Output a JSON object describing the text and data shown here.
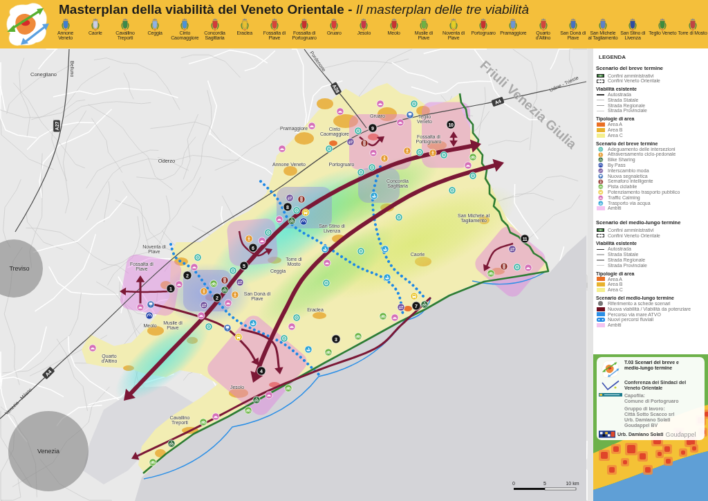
{
  "header": {
    "title": "**Masterplan della viabilità del Veneto Orientale -** *Il masterplan delle tre viabilità*",
    "municipalities": [
      {
        "name": "Annone Veneto",
        "color": "#3f7fd0"
      },
      {
        "name": "Caorle",
        "color": "#c9cfe6"
      },
      {
        "name": "Cavallino Treporti",
        "color": "#3c8a4a"
      },
      {
        "name": "Ceggia",
        "color": "#8fb3e3"
      },
      {
        "name": "Cinto Caomaggiore",
        "color": "#4b93d6"
      },
      {
        "name": "Concordia Sagittaria",
        "color": "#d33a3a"
      },
      {
        "name": "Eraclea",
        "color": "#e6c032"
      },
      {
        "name": "Fossalta di Piave",
        "color": "#d8443a"
      },
      {
        "name": "Fossalta di Portogruaro",
        "color": "#c82f2f"
      },
      {
        "name": "Gruaro",
        "color": "#d93c3c"
      },
      {
        "name": "Jesolo",
        "color": "#c9354a"
      },
      {
        "name": "Meolo",
        "color": "#c93232"
      },
      {
        "name": "Musile di Piave",
        "color": "#6cb244"
      },
      {
        "name": "Noventa di Piave",
        "color": "#e3d024"
      },
      {
        "name": "Portogruaro",
        "color": "#c73030"
      },
      {
        "name": "Pramaggiore",
        "color": "#6b96d4"
      },
      {
        "name": "Quarto d'Altino",
        "color": "#d2453e"
      },
      {
        "name": "San Donà di Piave",
        "color": "#4572c2"
      },
      {
        "name": "San Michele al Tagliamento",
        "color": "#5b82c9"
      },
      {
        "name": "San Stino di Livenza",
        "color": "#2c4ca2"
      },
      {
        "name": "Teglio Veneto",
        "color": "#3d8c3d"
      },
      {
        "name": "Torre di Mosto",
        "color": "#c14343"
      }
    ]
  },
  "map": {
    "places": [
      {
        "text": "Conegliano",
        "kind": "city"
      },
      {
        "text": "Oderzo",
        "kind": "city"
      },
      {
        "text": "Treviso",
        "kind": "hub"
      },
      {
        "text": "Venezia",
        "kind": "hub"
      },
      {
        "text": "Pramaggiore",
        "kind": "town"
      },
      {
        "text": "Cinto Caomaggiore",
        "kind": "town"
      },
      {
        "text": "Gruaro",
        "kind": "town"
      },
      {
        "text": "Teglio Veneto",
        "kind": "town"
      },
      {
        "text": "Annone Veneto",
        "kind": "town"
      },
      {
        "text": "Portogruaro",
        "kind": "town"
      },
      {
        "text": "Fossalta di Portogruaro",
        "kind": "town"
      },
      {
        "text": "Concordia Sagittaria",
        "kind": "town"
      },
      {
        "text": "San Michele al Tagliamento",
        "kind": "town"
      },
      {
        "text": "San Stino di Livenza",
        "kind": "town"
      },
      {
        "text": "Noventa di Piave",
        "kind": "town"
      },
      {
        "text": "Ceggia",
        "kind": "town"
      },
      {
        "text": "Caorle",
        "kind": "town"
      },
      {
        "text": "Torre di Mosto",
        "kind": "town"
      },
      {
        "text": "Fossalta di Piave",
        "kind": "town"
      },
      {
        "text": "San Donà di Piave",
        "kind": "town"
      },
      {
        "text": "Eraclea",
        "kind": "town"
      },
      {
        "text": "Meolo",
        "kind": "town"
      },
      {
        "text": "Musile di Piave",
        "kind": "town"
      },
      {
        "text": "Quarto d'Altino",
        "kind": "town"
      },
      {
        "text": "Jesolo",
        "kind": "town"
      },
      {
        "text": "Cavallino Treporti",
        "kind": "town"
      }
    ],
    "directions": [
      "Belluno",
      "Pordenone",
      "Udine - Trieste",
      "Venezia - Milano"
    ],
    "motorways": [
      "A27",
      "A28",
      "A4",
      "A4"
    ],
    "region_label": "Friuli Venezia Giulia",
    "markers": [
      "1",
      "2",
      "2",
      "3",
      "4",
      "5",
      "6",
      "7",
      "8",
      "9",
      "10",
      "11"
    ],
    "scale": [
      "0",
      "5",
      "10 km"
    ]
  },
  "legend": {
    "title": "LEGENDA",
    "blocks": [
      {
        "title": "Scenario del breve termine",
        "groups": [
          {
            "items": [
              {
                "label": "Confini amministrativi",
                "kind": "boundary"
              },
              {
                "label": "Confini Veneto Orientale",
                "kind": "dashed-boundary"
              }
            ]
          },
          {
            "heading": "Viabilità esistente",
            "items": [
              {
                "label": "Autostrada",
                "kind": "line",
                "color": "#333333"
              },
              {
                "label": "Strada Statale",
                "kind": "line",
                "color": "#b8b8b8"
              },
              {
                "label": "Strada Regionale",
                "kind": "line",
                "color": "#9a9a9a"
              },
              {
                "label": "Strada Provinciale",
                "kind": "line",
                "color": "#cacaca"
              }
            ]
          },
          {
            "heading": "Tipologie di area",
            "items": [
              {
                "label": "Area A",
                "kind": "swatch",
                "color": "#ea6f24"
              },
              {
                "label": "Area B",
                "kind": "swatch",
                "color": "#e8b22c"
              },
              {
                "label": "Area C",
                "kind": "swatch",
                "color": "#f4ef8c"
              }
            ]
          },
          {
            "heading": "Scenario del breve termine",
            "items": [
              {
                "label": "Adeguamento delle intersezioni",
                "kind": "roundabout"
              },
              {
                "label": "Attraversamento ciclo-pedonale",
                "kind": "pedestrian"
              },
              {
                "label": "Bike Sharing",
                "kind": "bike-sharing"
              },
              {
                "label": "By Pass",
                "kind": "bypass"
              },
              {
                "label": "Interscambio moda",
                "kind": "interchange"
              },
              {
                "label": "Nuova segnaletica",
                "kind": "sign"
              },
              {
                "label": "Semaforo intelligente",
                "kind": "traffic-light"
              },
              {
                "label": "Pista ciclabile",
                "kind": "bicycle"
              },
              {
                "label": "Potenziamento trasporto pubblico",
                "kind": "bus"
              },
              {
                "label": "Traffic Calming",
                "kind": "speed-bump"
              },
              {
                "label": "Trasporto via acqua",
                "kind": "boat"
              },
              {
                "label": "Ambiti",
                "kind": "swatch",
                "color": "#f3c4f0"
              }
            ]
          }
        ]
      },
      {
        "title": "Scenario del medio-lungo termine",
        "groups": [
          {
            "items": [
              {
                "label": "Confini amministrativi",
                "kind": "boundary"
              },
              {
                "label": "Confini Veneto Orientale",
                "kind": "dashed-boundary"
              }
            ]
          },
          {
            "heading": "Viabilità esistente",
            "items": [
              {
                "label": "Autostrada",
                "kind": "line",
                "color": "#333333"
              },
              {
                "label": "Strada Statale",
                "kind": "line",
                "color": "#b8b8b8"
              },
              {
                "label": "Strada Regionale",
                "kind": "line",
                "color": "#9a9a9a"
              },
              {
                "label": "Strada Provinciale",
                "kind": "line",
                "color": "#cacaca"
              }
            ]
          },
          {
            "heading": "Tipologie di area",
            "items": [
              {
                "label": "Area A",
                "kind": "swatch",
                "color": "#ea6f24"
              },
              {
                "label": "Area B",
                "kind": "swatch",
                "color": "#e8b22c"
              },
              {
                "label": "Area C",
                "kind": "swatch",
                "color": "#f4ef8c"
              }
            ]
          },
          {
            "heading": "Scenario del medio-lungo termine",
            "items": [
              {
                "label": "Riferimento a schede scenari",
                "kind": "dot"
              },
              {
                "label": "Nuova viabilità / Viabilità da potenziare",
                "kind": "swatch",
                "color": "#6e0f1f"
              },
              {
                "label": "Percorso via mare ATVO",
                "kind": "swatch",
                "color": "#2b8fe6"
              },
              {
                "label": "Nuovi percorsi fluviali",
                "kind": "dotted-line"
              },
              {
                "label": "Ambiti",
                "kind": "swatch",
                "color": "#f3c4f0"
              }
            ]
          }
        ]
      }
    ]
  },
  "credits": {
    "title": "T.03 Scenari del breve e medio-lungo termine",
    "conference": "Conferenza dei Sindaci del Veneto Orientale",
    "lead_label": "Capofila:",
    "lead": "Comune di Portogruaro",
    "team_label": "Gruppo di lavoro:",
    "team": [
      "Città Sotto Scacco srl",
      "Urb. Damiano Solati",
      "Goudappel BV"
    ],
    "footer_author": "Urb. Damiano Solati",
    "footer_logo": "Goudappel"
  }
}
